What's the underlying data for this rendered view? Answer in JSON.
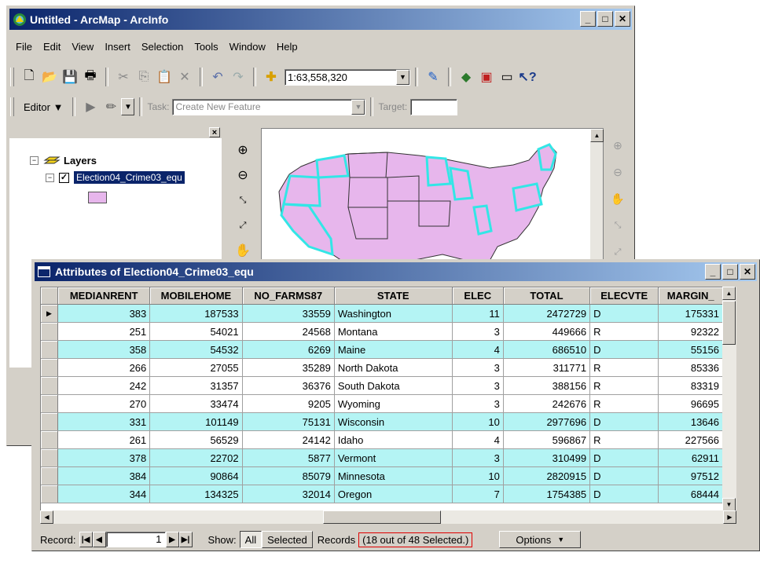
{
  "main_window": {
    "title": "Untitled - ArcMap - ArcInfo",
    "window_buttons": [
      "_",
      "□",
      "✕"
    ],
    "menu": [
      "File",
      "Edit",
      "View",
      "Insert",
      "Selection",
      "Tools",
      "Window",
      "Help"
    ],
    "scale": "1:63,558,320",
    "editor_label": "Editor ▼",
    "task_label": "Task:",
    "task_value": "Create New Feature",
    "target_label": "Target:"
  },
  "toc": {
    "root_label": "Layers",
    "layer_name": "Election04_Crime03_equ",
    "symbol_color": "#e7b6ec"
  },
  "map": {
    "fill_color": "#e7b6ec",
    "highlight_color": "#33e6e6"
  },
  "attributes_window": {
    "title": "Attributes of Election04_Crime03_equ",
    "columns": [
      "MEDIANRENT",
      "MOBILEHOME",
      "NO_FARMS87",
      "STATE",
      "ELEC",
      "TOTAL",
      "ELECVTE",
      "MARGIN_"
    ],
    "rows": [
      {
        "cells": [
          "383",
          "187533",
          "33559",
          "Washington",
          "11",
          "2472729",
          "D",
          "175331"
        ],
        "selected": true,
        "current": true
      },
      {
        "cells": [
          "251",
          "54021",
          "24568",
          "Montana",
          "3",
          "449666",
          "R",
          "92322"
        ],
        "selected": false,
        "current": false
      },
      {
        "cells": [
          "358",
          "54532",
          "6269",
          "Maine",
          "4",
          "686510",
          "D",
          "55156"
        ],
        "selected": true,
        "current": false
      },
      {
        "cells": [
          "266",
          "27055",
          "35289",
          "North Dakota",
          "3",
          "311771",
          "R",
          "85336"
        ],
        "selected": false,
        "current": false
      },
      {
        "cells": [
          "242",
          "31357",
          "36376",
          "South Dakota",
          "3",
          "388156",
          "R",
          "83319"
        ],
        "selected": false,
        "current": false
      },
      {
        "cells": [
          "270",
          "33474",
          "9205",
          "Wyoming",
          "3",
          "242676",
          "R",
          "96695"
        ],
        "selected": false,
        "current": false
      },
      {
        "cells": [
          "331",
          "101149",
          "75131",
          "Wisconsin",
          "10",
          "2977696",
          "D",
          "13646"
        ],
        "selected": true,
        "current": false
      },
      {
        "cells": [
          "261",
          "56529",
          "24142",
          "Idaho",
          "4",
          "596867",
          "R",
          "227566"
        ],
        "selected": false,
        "current": false
      },
      {
        "cells": [
          "378",
          "22702",
          "5877",
          "Vermont",
          "3",
          "310499",
          "D",
          "62911"
        ],
        "selected": true,
        "current": false
      },
      {
        "cells": [
          "384",
          "90864",
          "85079",
          "Minnesota",
          "10",
          "2820915",
          "D",
          "97512"
        ],
        "selected": true,
        "current": false
      },
      {
        "cells": [
          "344",
          "134325",
          "32014",
          "Oregon",
          "7",
          "1754385",
          "D",
          "68444"
        ],
        "selected": true,
        "current": false
      }
    ],
    "highlight_color": "#b4f4f4",
    "record_label": "Record:",
    "record_value": "1",
    "show_label": "Show:",
    "all_label": "All",
    "selected_label": "Selected",
    "records_label": "Records",
    "records_count": "(18 out of 48 Selected.)",
    "options_label": "Options"
  }
}
